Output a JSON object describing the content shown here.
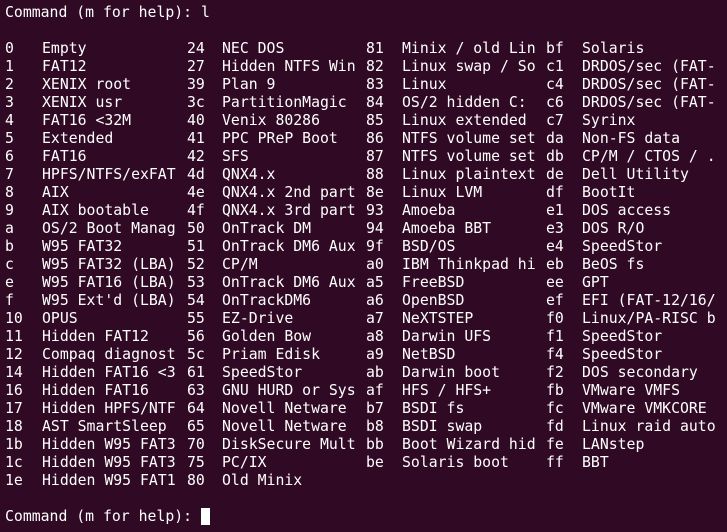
{
  "prompt_top": "Command (m for help): l",
  "prompt_bottom": "Command (m for help): ",
  "colors": {
    "background": "#300a24",
    "text": "#ffffff"
  },
  "rows": [
    [
      [
        "0",
        "Empty"
      ],
      [
        "24",
        "NEC DOS"
      ],
      [
        "81",
        "Minix / old Lin"
      ],
      [
        "bf",
        "Solaris"
      ]
    ],
    [
      [
        "1",
        "FAT12"
      ],
      [
        "27",
        "Hidden NTFS Win"
      ],
      [
        "82",
        "Linux swap / So"
      ],
      [
        "c1",
        "DRDOS/sec (FAT-"
      ]
    ],
    [
      [
        "2",
        "XENIX root"
      ],
      [
        "39",
        "Plan 9"
      ],
      [
        "83",
        "Linux"
      ],
      [
        "c4",
        "DRDOS/sec (FAT-"
      ]
    ],
    [
      [
        "3",
        "XENIX usr"
      ],
      [
        "3c",
        "PartitionMagic"
      ],
      [
        "84",
        "OS/2 hidden C:"
      ],
      [
        "c6",
        "DRDOS/sec (FAT-"
      ]
    ],
    [
      [
        "4",
        "FAT16 <32M"
      ],
      [
        "40",
        "Venix 80286"
      ],
      [
        "85",
        "Linux extended"
      ],
      [
        "c7",
        "Syrinx"
      ]
    ],
    [
      [
        "5",
        "Extended"
      ],
      [
        "41",
        "PPC PReP Boot"
      ],
      [
        "86",
        "NTFS volume set"
      ],
      [
        "da",
        "Non-FS data"
      ]
    ],
    [
      [
        "6",
        "FAT16"
      ],
      [
        "42",
        "SFS"
      ],
      [
        "87",
        "NTFS volume set"
      ],
      [
        "db",
        "CP/M / CTOS / ."
      ]
    ],
    [
      [
        "7",
        "HPFS/NTFS/exFAT"
      ],
      [
        "4d",
        "QNX4.x"
      ],
      [
        "88",
        "Linux plaintext"
      ],
      [
        "de",
        "Dell Utility"
      ]
    ],
    [
      [
        "8",
        "AIX"
      ],
      [
        "4e",
        "QNX4.x 2nd part"
      ],
      [
        "8e",
        "Linux LVM"
      ],
      [
        "df",
        "BootIt"
      ]
    ],
    [
      [
        "9",
        "AIX bootable"
      ],
      [
        "4f",
        "QNX4.x 3rd part"
      ],
      [
        "93",
        "Amoeba"
      ],
      [
        "e1",
        "DOS access"
      ]
    ],
    [
      [
        "a",
        "OS/2 Boot Manag"
      ],
      [
        "50",
        "OnTrack DM"
      ],
      [
        "94",
        "Amoeba BBT"
      ],
      [
        "e3",
        "DOS R/O"
      ]
    ],
    [
      [
        "b",
        "W95 FAT32"
      ],
      [
        "51",
        "OnTrack DM6 Aux"
      ],
      [
        "9f",
        "BSD/OS"
      ],
      [
        "e4",
        "SpeedStor"
      ]
    ],
    [
      [
        "c",
        "W95 FAT32 (LBA)"
      ],
      [
        "52",
        "CP/M"
      ],
      [
        "a0",
        "IBM Thinkpad hi"
      ],
      [
        "eb",
        "BeOS fs"
      ]
    ],
    [
      [
        "e",
        "W95 FAT16 (LBA)"
      ],
      [
        "53",
        "OnTrack DM6 Aux"
      ],
      [
        "a5",
        "FreeBSD"
      ],
      [
        "ee",
        "GPT"
      ]
    ],
    [
      [
        "f",
        "W95 Ext'd (LBA)"
      ],
      [
        "54",
        "OnTrackDM6"
      ],
      [
        "a6",
        "OpenBSD"
      ],
      [
        "ef",
        "EFI (FAT-12/16/"
      ]
    ],
    [
      [
        "10",
        "OPUS"
      ],
      [
        "55",
        "EZ-Drive"
      ],
      [
        "a7",
        "NeXTSTEP"
      ],
      [
        "f0",
        "Linux/PA-RISC b"
      ]
    ],
    [
      [
        "11",
        "Hidden FAT12"
      ],
      [
        "56",
        "Golden Bow"
      ],
      [
        "a8",
        "Darwin UFS"
      ],
      [
        "f1",
        "SpeedStor"
      ]
    ],
    [
      [
        "12",
        "Compaq diagnost"
      ],
      [
        "5c",
        "Priam Edisk"
      ],
      [
        "a9",
        "NetBSD"
      ],
      [
        "f4",
        "SpeedStor"
      ]
    ],
    [
      [
        "14",
        "Hidden FAT16 <3"
      ],
      [
        "61",
        "SpeedStor"
      ],
      [
        "ab",
        "Darwin boot"
      ],
      [
        "f2",
        "DOS secondary"
      ]
    ],
    [
      [
        "16",
        "Hidden FAT16"
      ],
      [
        "63",
        "GNU HURD or Sys"
      ],
      [
        "af",
        "HFS / HFS+"
      ],
      [
        "fb",
        "VMware VMFS"
      ]
    ],
    [
      [
        "17",
        "Hidden HPFS/NTF"
      ],
      [
        "64",
        "Novell Netware"
      ],
      [
        "b7",
        "BSDI fs"
      ],
      [
        "fc",
        "VMware VMKCORE"
      ]
    ],
    [
      [
        "18",
        "AST SmartSleep"
      ],
      [
        "65",
        "Novell Netware"
      ],
      [
        "b8",
        "BSDI swap"
      ],
      [
        "fd",
        "Linux raid auto"
      ]
    ],
    [
      [
        "1b",
        "Hidden W95 FAT3"
      ],
      [
        "70",
        "DiskSecure Mult"
      ],
      [
        "bb",
        "Boot Wizard hid"
      ],
      [
        "fe",
        "LANstep"
      ]
    ],
    [
      [
        "1c",
        "Hidden W95 FAT3"
      ],
      [
        "75",
        "PC/IX"
      ],
      [
        "be",
        "Solaris boot"
      ],
      [
        "ff",
        "BBT"
      ]
    ],
    [
      [
        "1e",
        "Hidden W95 FAT1"
      ],
      [
        "80",
        "Old Minix"
      ]
    ]
  ]
}
